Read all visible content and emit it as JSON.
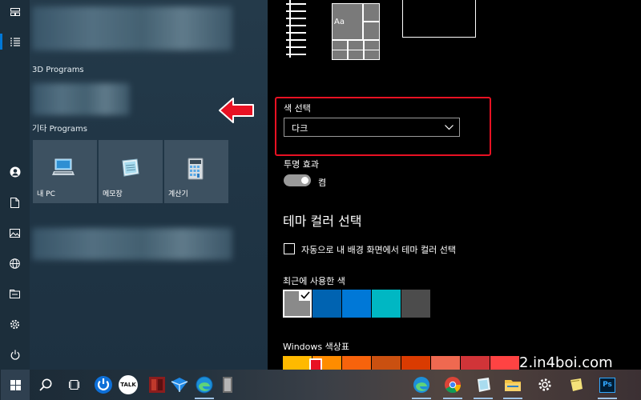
{
  "start_menu": {
    "groups": [
      {
        "label": "3D Programs"
      },
      {
        "label": "기타 Programs"
      }
    ],
    "tiles": [
      {
        "label": "내 PC"
      },
      {
        "label": "메모장"
      },
      {
        "label": "계산기"
      }
    ],
    "tile_icons": [
      "computer-icon",
      "notepad-icon",
      "calculator-icon"
    ]
  },
  "preview": {
    "tile_text": "Aa"
  },
  "settings": {
    "color_choice_label": "색 선택",
    "color_choice_value": "다크",
    "transparency_label": "투명 효과",
    "transparency_state": "켬",
    "transparency_on": true,
    "accent_heading": "테마 컬러 선택",
    "auto_accent_label": "자동으로 내 배경 화면에서 테마 컬러 선택",
    "auto_accent_checked": false,
    "recent_colors_label": "최근에 사용한 색",
    "recent_colors": [
      "#8a8a8a",
      "#0063b1",
      "#0078d7",
      "#00b7c3",
      "#4c4c4c"
    ],
    "palette_label": "Windows 색상표",
    "palette_colors": [
      "#ffb900",
      "#ff8c00",
      "#f7630c",
      "#ca5010",
      "#da3b01",
      "#ef6950",
      "#d13438",
      "#ff4343"
    ]
  },
  "watermark": "2.in4boi.com",
  "colors": {
    "annotation_red": "#e81123",
    "arrow_red": "#e81123",
    "accent_blue": "#0078d7"
  },
  "taskbar": {
    "items": [
      "start-icon",
      "search-icon",
      "task-view-icon",
      "power-app-icon",
      "talk-app-icon",
      "book-app-icon",
      "vpn-app-icon",
      "edge-icon",
      "archive-icon",
      "edge-icon",
      "chrome-icon",
      "notepad-icon",
      "file-explorer-icon",
      "settings-icon",
      "sticky-notes-icon",
      "photoshop-icon"
    ],
    "talk_label": "TALK",
    "ps_label": "Ps"
  }
}
